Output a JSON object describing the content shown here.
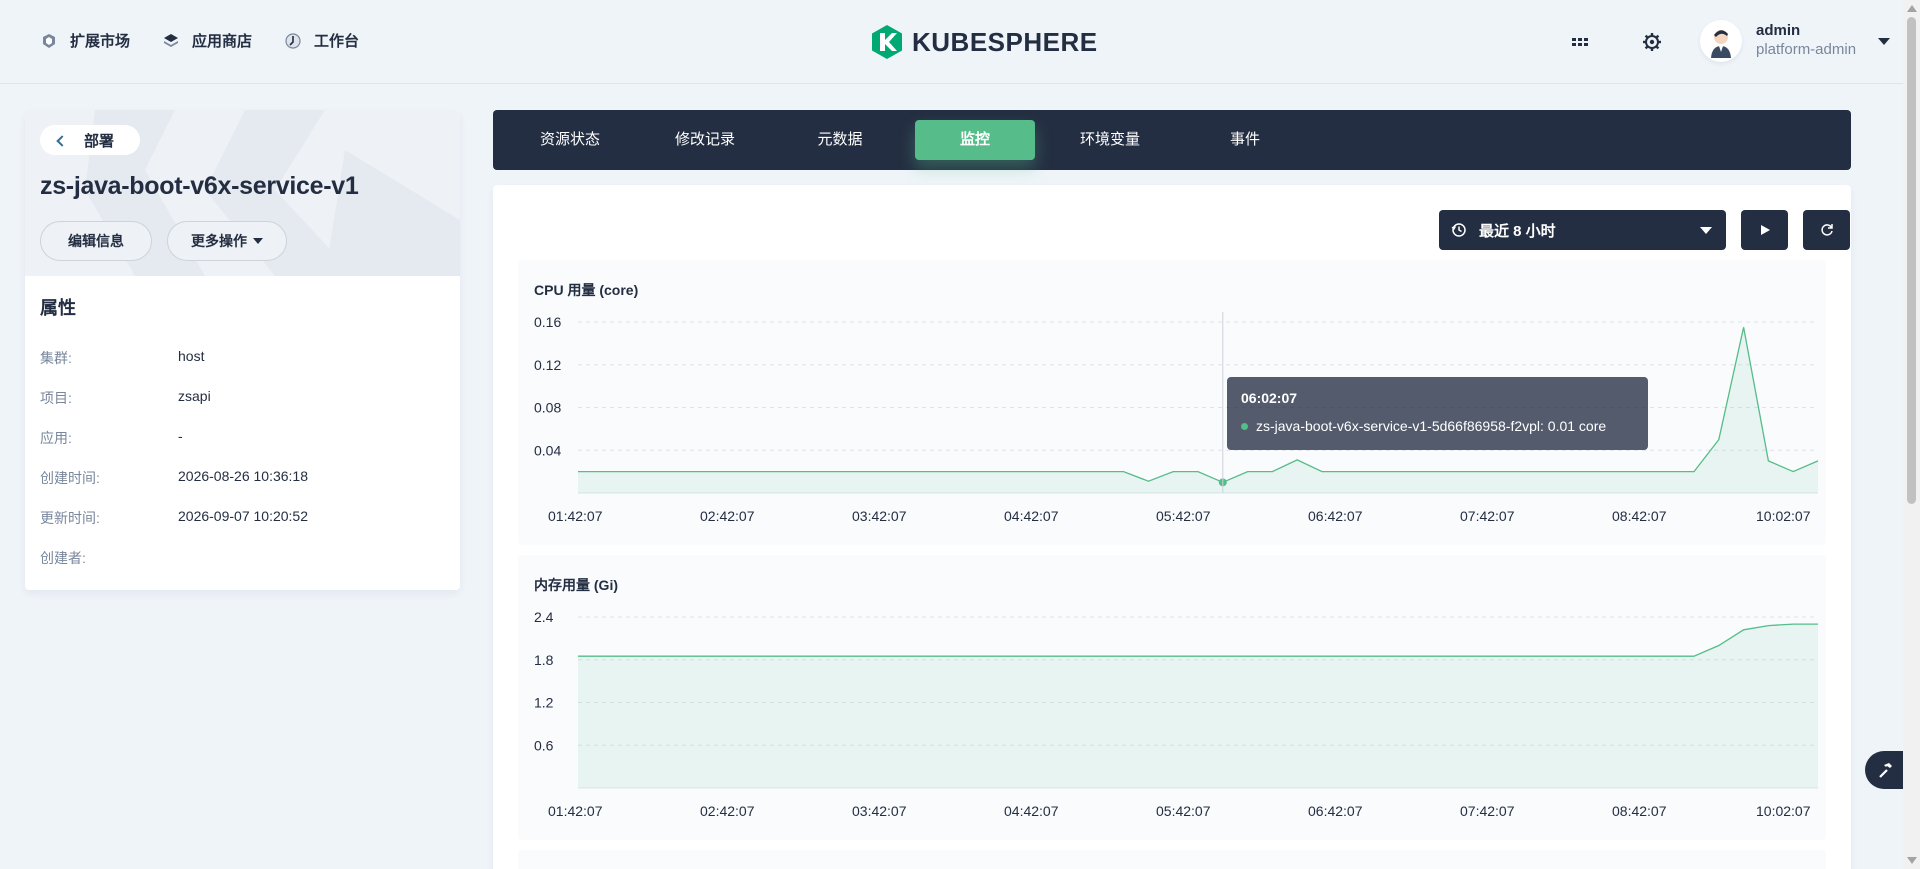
{
  "topnav": {
    "items": [
      {
        "label": "扩展市场",
        "icon": "extensions-icon"
      },
      {
        "label": "应用商店",
        "icon": "app-store-icon"
      },
      {
        "label": "工作台",
        "icon": "workbench-icon"
      }
    ]
  },
  "logo": {
    "text": "KUBESPHERE",
    "color": "#00a971"
  },
  "user": {
    "name": "admin",
    "role": "platform-admin"
  },
  "resource": {
    "back_label": "部署",
    "name": "zs-java-boot-v6x-service-v1",
    "edit_label": "编辑信息",
    "more_label": "更多操作"
  },
  "properties": {
    "title": "属性",
    "rows": [
      {
        "key": "集群:",
        "value": "host"
      },
      {
        "key": "项目:",
        "value": "zsapi"
      },
      {
        "key": "应用:",
        "value": "-"
      },
      {
        "key": "创建时间:",
        "value": "2026-08-26 10:36:18"
      },
      {
        "key": "更新时间:",
        "value": "2026-09-07 10:20:52"
      },
      {
        "key": "创建者:",
        "value": ""
      }
    ]
  },
  "tabs": [
    {
      "label": "资源状态",
      "active": false
    },
    {
      "label": "修改记录",
      "active": false
    },
    {
      "label": "元数据",
      "active": false
    },
    {
      "label": "监控",
      "active": true
    },
    {
      "label": "环境变量",
      "active": false
    },
    {
      "label": "事件",
      "active": false
    }
  ],
  "monitor": {
    "time_range_label": "最近 8 小时"
  },
  "tooltip": {
    "time": "06:02:07",
    "text": "zs-java-boot-v6x-service-v1-5d66f86958-f2vpl: 0.01 core"
  },
  "colors": {
    "accent": "#55bc8a",
    "dark": "#242e42",
    "muted": "#79879c"
  },
  "chart_data": [
    {
      "type": "area",
      "title": "CPU 用量 (core)",
      "x": [
        "01:42:07",
        "02:42:07",
        "03:42:07",
        "04:42:07",
        "05:42:07",
        "06:42:07",
        "07:42:07",
        "08:42:07",
        "10:02:07"
      ],
      "yticks": [
        0.16,
        0.12,
        0.08,
        0.04
      ],
      "ylim": [
        0,
        0.16
      ],
      "grid": true,
      "series": [
        {
          "values": [
            0.02,
            0.02,
            0.02,
            0.02,
            0.02,
            0.02,
            0.02,
            0.02,
            0.02,
            0.02,
            0.02,
            0.02,
            0.02,
            0.02,
            0.02,
            0.02,
            0.02,
            0.02,
            0.02,
            0.02,
            0.02,
            0.02,
            0.02,
            0.011,
            0.02,
            0.02,
            0.01,
            0.02,
            0.02,
            0.031,
            0.02,
            0.02,
            0.02,
            0.02,
            0.02,
            0.02,
            0.02,
            0.02,
            0.02,
            0.02,
            0.02,
            0.02,
            0.02,
            0.02,
            0.02,
            0.02,
            0.05,
            0.155,
            0.03,
            0.02,
            0.03
          ]
        }
      ]
    },
    {
      "type": "area",
      "title": "内存用量 (Gi)",
      "x": [
        "01:42:07",
        "02:42:07",
        "03:42:07",
        "04:42:07",
        "05:42:07",
        "06:42:07",
        "07:42:07",
        "08:42:07",
        "10:02:07"
      ],
      "yticks": [
        2.4,
        1.8,
        1.2,
        0.6
      ],
      "ylim": [
        0,
        2.4
      ],
      "grid": true,
      "series": [
        {
          "values": [
            1.85,
            1.85,
            1.85,
            1.85,
            1.85,
            1.85,
            1.85,
            1.85,
            1.85,
            1.85,
            1.85,
            1.85,
            1.85,
            1.85,
            1.85,
            1.85,
            1.85,
            1.85,
            1.85,
            1.85,
            1.85,
            1.85,
            1.85,
            1.85,
            1.85,
            1.85,
            1.85,
            1.85,
            1.85,
            1.85,
            1.85,
            1.85,
            1.85,
            1.85,
            1.85,
            1.85,
            1.85,
            1.85,
            1.85,
            1.85,
            1.85,
            1.85,
            1.85,
            1.85,
            1.85,
            1.85,
            2.0,
            2.22,
            2.28,
            2.3,
            2.3
          ]
        }
      ]
    }
  ]
}
